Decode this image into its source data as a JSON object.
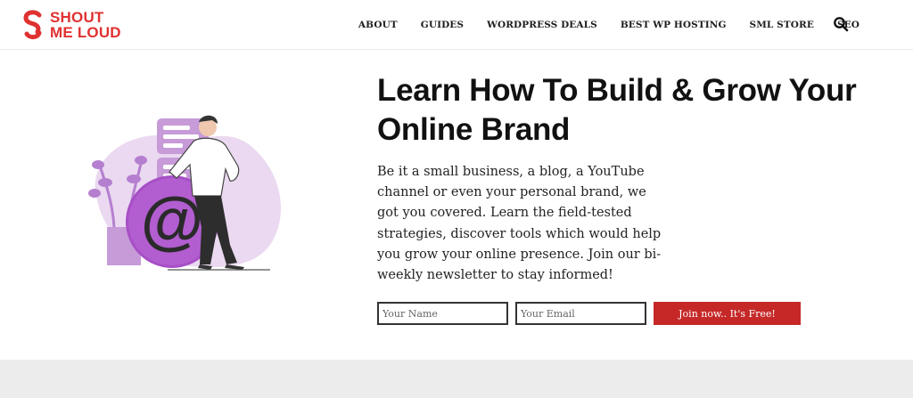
{
  "brand": {
    "logo_line1": "SHOUT",
    "logo_line2": "ME LOUD",
    "accent": "#e03131"
  },
  "nav": {
    "items": [
      {
        "label": "ABOUT"
      },
      {
        "label": "GUIDES"
      },
      {
        "label": "WORDPRESS DEALS"
      },
      {
        "label": "BEST WP HOSTING"
      },
      {
        "label": "SML STORE"
      },
      {
        "label": "SEO"
      }
    ],
    "search_icon": "search-icon"
  },
  "hero": {
    "headline": "Learn How To Build & Grow Your Online Brand",
    "description": "Be it a small business, a blog, a YouTube channel or even your personal brand, we got you covered. Learn the field-tested strategies, discover tools which would help you grow your online presence. Join our bi-weekly newsletter to stay informed!",
    "illustration_icon": "at-sign-illustration"
  },
  "form": {
    "name_placeholder": "Your Name",
    "email_placeholder": "Your Email",
    "submit_label": "Join now.. It's Free!",
    "submit_color": "#c62828"
  }
}
